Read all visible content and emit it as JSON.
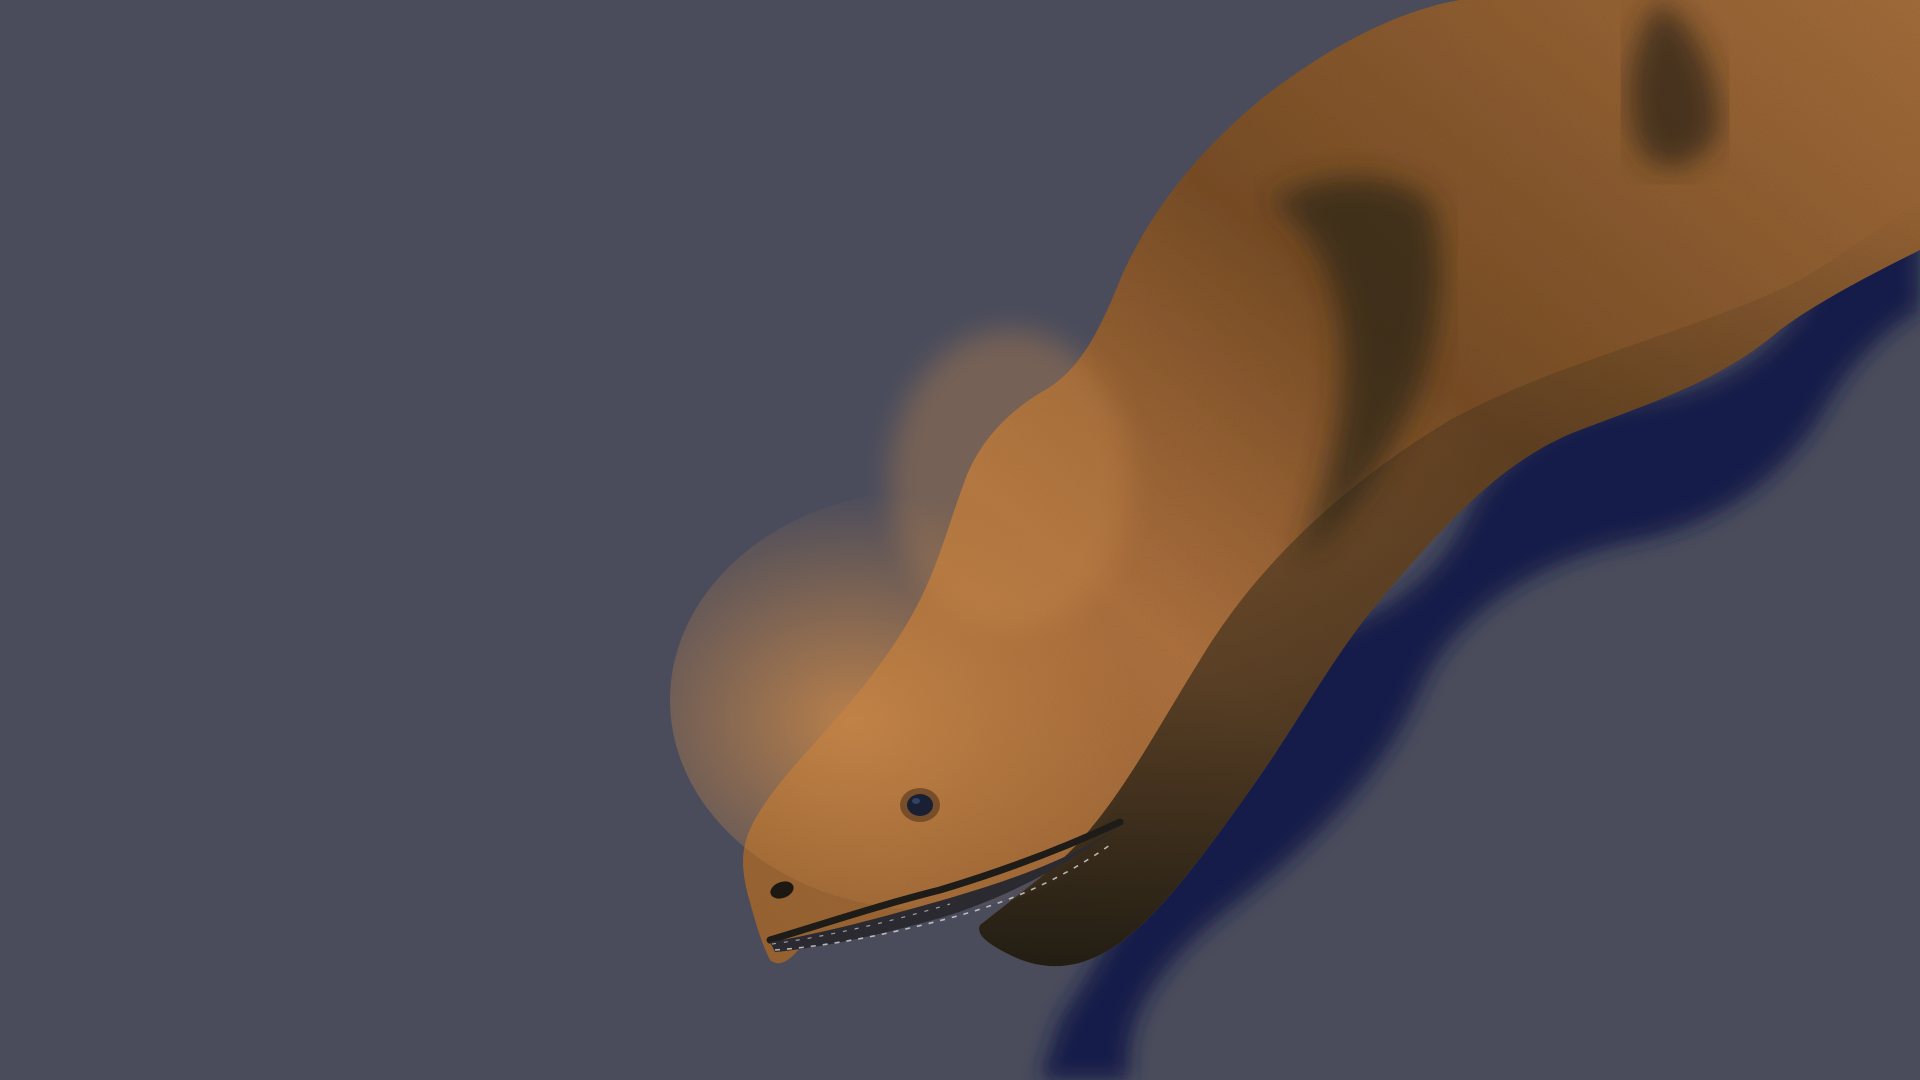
{
  "scene": {
    "subject": "eel-head-render",
    "icon": "eel-icon",
    "colors": {
      "background": "#4a4c5c",
      "shadow": "#141f4a",
      "skin_light": "#b87840",
      "skin_mid": "#8a5a2e",
      "skin_dark": "#2a2418",
      "eye": "#1a2033",
      "mouth_interior": "#2a2a30",
      "teeth": "#cfcfcf"
    }
  }
}
